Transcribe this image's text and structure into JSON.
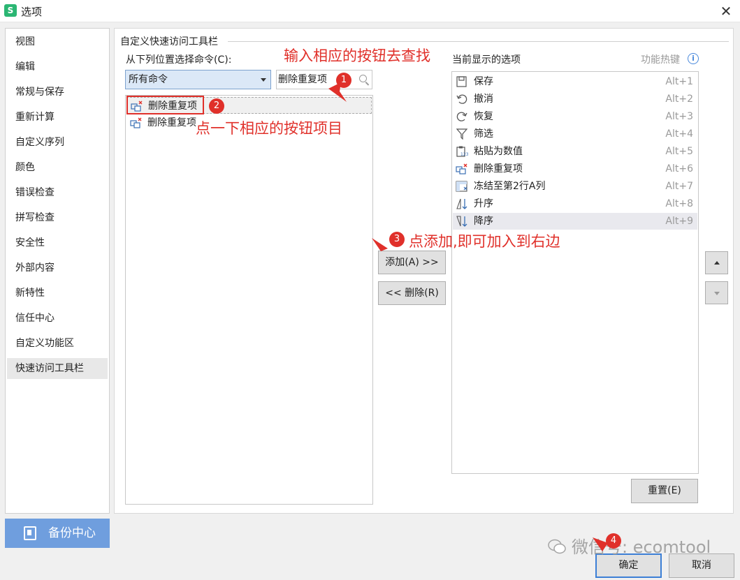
{
  "window": {
    "title": "选项",
    "app_icon_glyph": "S",
    "close_glyph": "✕"
  },
  "sidebar": {
    "items": [
      {
        "label": "视图"
      },
      {
        "label": "编辑"
      },
      {
        "label": "常规与保存"
      },
      {
        "label": "重新计算"
      },
      {
        "label": "自定义序列"
      },
      {
        "label": "颜色"
      },
      {
        "label": "错误检查"
      },
      {
        "label": "拼写检查"
      },
      {
        "label": "安全性"
      },
      {
        "label": "外部内容"
      },
      {
        "label": "新特性"
      },
      {
        "label": "信任中心"
      },
      {
        "label": "自定义功能区"
      },
      {
        "label": "快速访问工具栏"
      }
    ],
    "active_index": 13,
    "backup_label": "备份中心"
  },
  "panel": {
    "group_title": "自定义快速访问工具栏",
    "choose_label": "从下列位置选择命令(C):",
    "select_value": "所有命令",
    "search_value": "删除重复项",
    "left_list": [
      {
        "label": "删除重复项",
        "icon": "remove-duplicates-icon",
        "selected": true
      },
      {
        "label": "删除重复项",
        "icon": "remove-duplicates-icon",
        "selected": false
      }
    ],
    "add_button": "添加(A) >>",
    "remove_button": "<< 删除(R)",
    "current_label": "当前显示的选项",
    "hotkey_label": "功能热键",
    "right_list": [
      {
        "label": "保存",
        "key": "Alt+1",
        "icon": "save-icon"
      },
      {
        "label": "撤消",
        "key": "Alt+2",
        "icon": "undo-icon"
      },
      {
        "label": "恢复",
        "key": "Alt+3",
        "icon": "redo-icon"
      },
      {
        "label": "筛选",
        "key": "Alt+4",
        "icon": "filter-icon"
      },
      {
        "label": "粘贴为数值",
        "key": "Alt+5",
        "icon": "paste-values-icon"
      },
      {
        "label": "删除重复项",
        "key": "Alt+6",
        "icon": "remove-duplicates-icon"
      },
      {
        "label": "冻结至第2行A列",
        "key": "Alt+7",
        "icon": "freeze-panes-icon"
      },
      {
        "label": "升序",
        "key": "Alt+8",
        "icon": "sort-ascending-icon"
      },
      {
        "label": "降序",
        "key": "Alt+9",
        "icon": "sort-descending-icon"
      }
    ],
    "right_selected_index": 8,
    "reset_button": "重置(E)"
  },
  "footer": {
    "ok_button": "确定",
    "cancel_button": "取消"
  },
  "annotations": {
    "step1_text": "输入相应的按钮去查找",
    "step2_text": "点一下相应的按钮项目",
    "step3_text": "点添加,即可加入到右边",
    "badges": [
      "1",
      "2",
      "3",
      "4"
    ],
    "color": "#e0302a"
  },
  "watermark": {
    "text": "微信号: ecomtool"
  },
  "colors": {
    "accent": "#3c7fd6",
    "backup_bg": "#6f9ede",
    "select_bg": "#dbe8f7"
  }
}
